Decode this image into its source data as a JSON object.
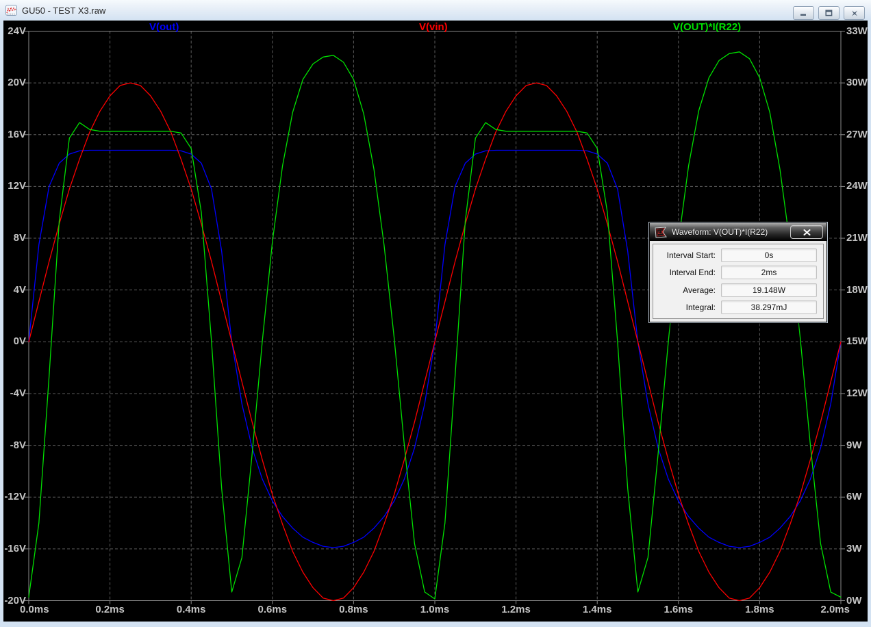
{
  "window": {
    "title": "GU50 - TEST X3.raw"
  },
  "icons": {
    "app": "waveform-file-icon",
    "minimize": "minimize-icon",
    "restore": "restore-icon",
    "close": "close-icon",
    "dialog_logo": "lt-flag-icon",
    "dialog_close": "close-x-icon"
  },
  "dialog": {
    "title": "Waveform: V(OUT)*I(R22)",
    "rows": [
      {
        "label": "Interval Start:",
        "value": "0s"
      },
      {
        "label": "Interval End:",
        "value": "2ms"
      },
      {
        "label": "Average:",
        "value": "19.148W"
      },
      {
        "label": "Integral:",
        "value": "38.297mJ"
      }
    ]
  },
  "colors": {
    "plot_background": "#000000",
    "grid": "#5d5d5d",
    "frame": "#8c8c8c",
    "axis_text": "#c4c4c4",
    "trace_blue": "#0000ff",
    "trace_red": "#ff0000",
    "trace_green": "#00e000"
  },
  "chart_data": {
    "type": "line",
    "title": "",
    "grid": true,
    "background": "#000000",
    "x_axis": {
      "unit": "ms",
      "min": 0,
      "max": 2,
      "tick_step": 0.2,
      "tick_labels": [
        "0.0ms",
        "0.2ms",
        "0.4ms",
        "0.6ms",
        "0.8ms",
        "1.0ms",
        "1.2ms",
        "1.4ms",
        "1.6ms",
        "1.8ms",
        "2.0ms"
      ]
    },
    "y_left": {
      "unit": "V",
      "min": -20,
      "max": 24,
      "tick_step": 4,
      "tick_labels": [
        "24V",
        "20V",
        "16V",
        "12V",
        "8V",
        "4V",
        "0V",
        "-4V",
        "-8V",
        "-12V",
        "-16V",
        "-20V"
      ]
    },
    "y_right": {
      "unit": "W",
      "min": 0,
      "max": 33,
      "tick_step": 3,
      "tick_labels": [
        "33W",
        "30W",
        "27W",
        "24W",
        "21W",
        "18W",
        "15W",
        "12W",
        "9W",
        "6W",
        "3W",
        "0W"
      ]
    },
    "t_step_ms": 0.025,
    "series": [
      {
        "name": "V(out)",
        "color": "#0000ff",
        "axis": "left",
        "values": [
          0,
          7.5,
          12,
          13.8,
          14.5,
          14.75,
          14.8,
          14.8,
          14.8,
          14.8,
          14.8,
          14.8,
          14.8,
          14.8,
          14.8,
          14.75,
          14.5,
          13.8,
          11.8,
          7,
          0,
          -4.8,
          -8.2,
          -10.6,
          -12.3,
          -13.5,
          -14.4,
          -15.1,
          -15.5,
          -15.8,
          -15.9,
          -15.8,
          -15.5,
          -15.1,
          -14.4,
          -13.5,
          -12.3,
          -10.6,
          -8.2,
          -4.8,
          0,
          7.5,
          12,
          13.8,
          14.5,
          14.75,
          14.8,
          14.8,
          14.8,
          14.8,
          14.8,
          14.8,
          14.8,
          14.8,
          14.8,
          14.75,
          14.5,
          13.8,
          11.8,
          7,
          0,
          -4.8,
          -8.2,
          -10.6,
          -12.3,
          -13.5,
          -14.4,
          -15.1,
          -15.5,
          -15.8,
          -15.9,
          -15.8,
          -15.5,
          -15.1,
          -14.4,
          -13.5,
          -12.3,
          -10.6,
          -8.2,
          -4.8,
          0
        ]
      },
      {
        "name": "V(vin)",
        "color": "#ff0000",
        "axis": "left",
        "values": [
          0,
          3.1,
          6.2,
          9.1,
          11.8,
          14.1,
          16.2,
          17.8,
          19,
          19.8,
          20,
          19.8,
          19,
          17.8,
          16.2,
          14.1,
          11.8,
          9.1,
          6.2,
          3.1,
          0,
          -3.1,
          -6.2,
          -9.1,
          -11.8,
          -14.1,
          -16.2,
          -17.8,
          -19,
          -19.8,
          -20,
          -19.8,
          -19,
          -17.8,
          -16.2,
          -14.1,
          -11.8,
          -9.1,
          -6.2,
          -3.1,
          0,
          3.1,
          6.2,
          9.1,
          11.8,
          14.1,
          16.2,
          17.8,
          19,
          19.8,
          20,
          19.8,
          19,
          17.8,
          16.2,
          14.1,
          11.8,
          9.1,
          6.2,
          3.1,
          0,
          -3.1,
          -6.2,
          -9.1,
          -11.8,
          -14.1,
          -16.2,
          -17.8,
          -19,
          -19.8,
          -20,
          -19.8,
          -19,
          -17.8,
          -16.2,
          -14.1,
          -11.8,
          -9.1,
          -6.2,
          -3.1,
          0
        ]
      },
      {
        "name": "V(OUT)*I(R22)",
        "color": "#00e000",
        "axis": "right",
        "values": [
          0.2,
          4.5,
          13,
          22,
          26.8,
          27.7,
          27.3,
          27.2,
          27.2,
          27.2,
          27.2,
          27.2,
          27.2,
          27.2,
          27.2,
          27.1,
          26.2,
          22.5,
          15,
          6.5,
          0.5,
          2.5,
          8.5,
          15,
          20.8,
          25.2,
          28.3,
          30.2,
          31.1,
          31.5,
          31.6,
          31.2,
          30.2,
          28.2,
          25,
          20.6,
          15.2,
          9,
          3.3,
          0.5,
          0.1,
          4.5,
          13,
          22,
          26.8,
          27.7,
          27.3,
          27.2,
          27.2,
          27.2,
          27.2,
          27.2,
          27.2,
          27.2,
          27.2,
          27.1,
          26.2,
          22.5,
          15,
          6.5,
          0.5,
          2.5,
          8.5,
          15,
          20.8,
          25.2,
          28.4,
          30.3,
          31.3,
          31.7,
          31.8,
          31.4,
          30.3,
          28.3,
          25,
          20.6,
          15.2,
          9,
          3.3,
          0.5,
          0.2
        ]
      }
    ]
  }
}
